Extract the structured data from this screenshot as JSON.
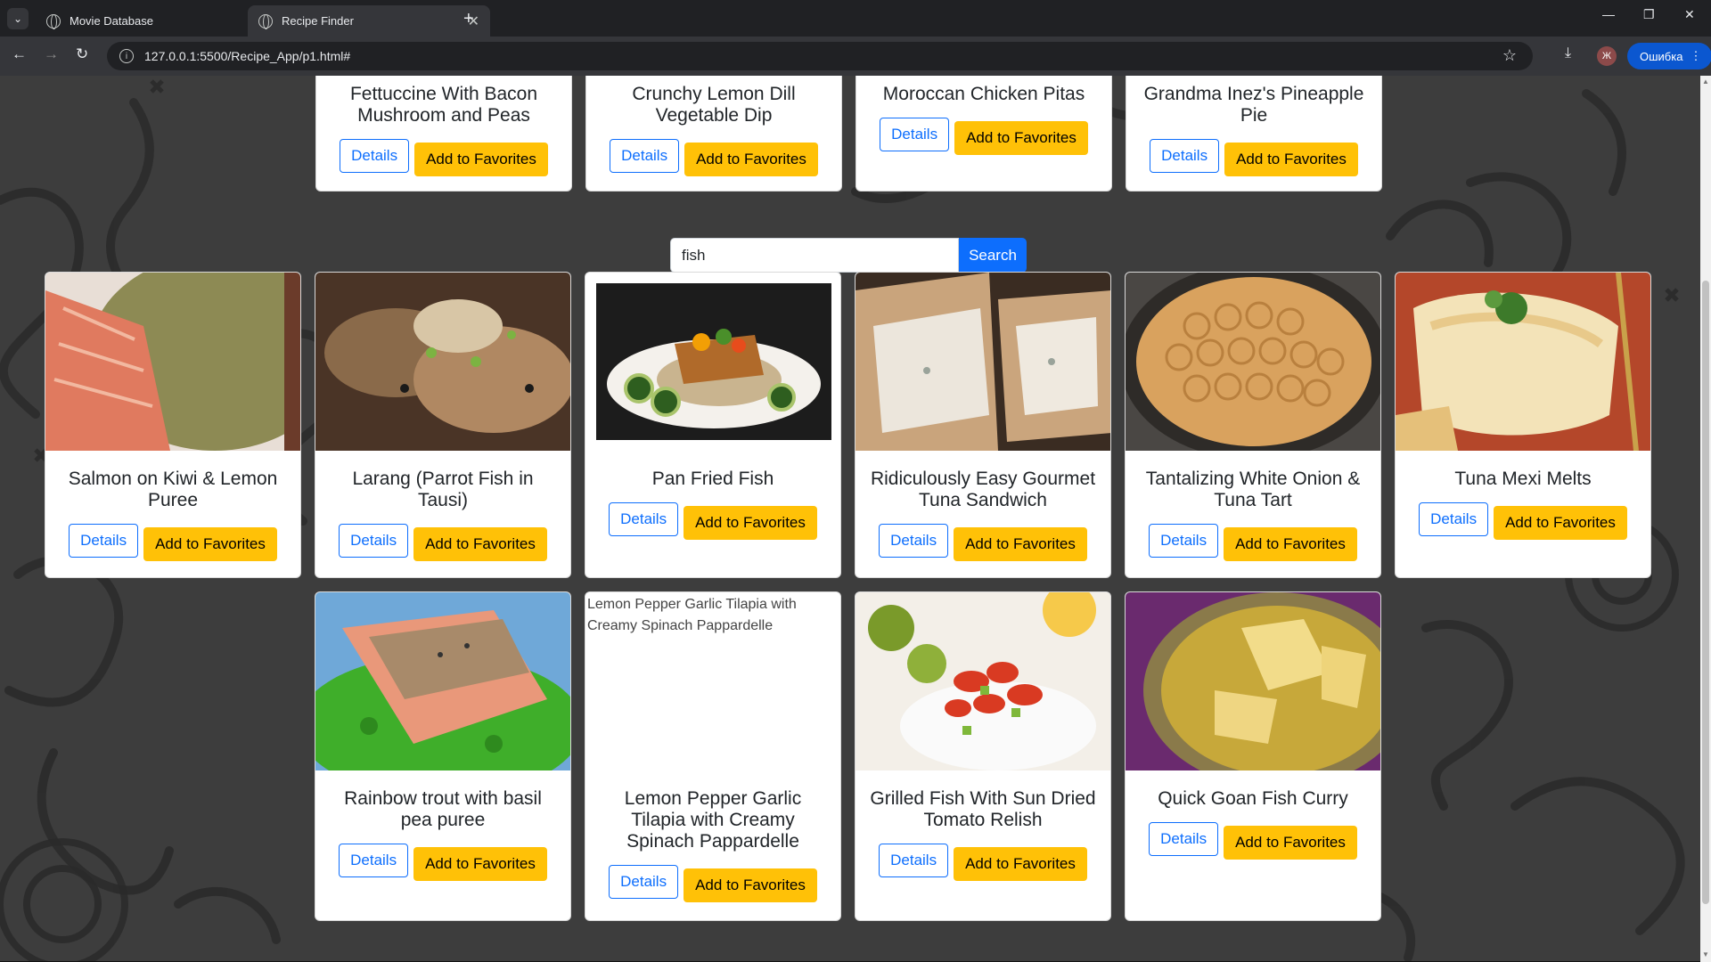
{
  "browser": {
    "tabs": [
      {
        "title": "Movie Database",
        "active": false
      },
      {
        "title": "Recipe Finder",
        "active": true
      }
    ],
    "url": "127.0.0.1:5500/Recipe_App/p1.html#",
    "profile_initial": "Ж",
    "error_button": "Ошибка"
  },
  "search": {
    "value": "fish",
    "button": "Search"
  },
  "labels": {
    "details": "Details",
    "favorite": "Add to Favorites"
  },
  "top_cards": [
    {
      "title": "Fettuccine With Bacon Mushroom and Peas"
    },
    {
      "title": "Crunchy Lemon Dill Vegetable Dip"
    },
    {
      "title": "Moroccan Chicken Pitas"
    },
    {
      "title": "Grandma Inez's Pineapple Pie"
    }
  ],
  "results": [
    {
      "title": "Salmon on Kiwi & Lemon Puree",
      "image": "salmon-on-kiwi-puree"
    },
    {
      "title": "Larang (Parrot Fish in Tausi)",
      "image": "larang-parrot-fish"
    },
    {
      "title": "Pan Fried Fish",
      "image": "pan-fried-fish"
    },
    {
      "title": "Ridiculously Easy Gourmet Tuna Sandwich",
      "image": "tuna-sandwich"
    },
    {
      "title": "Tantalizing White Onion & Tuna Tart",
      "image": "onion-tuna-tart"
    },
    {
      "title": "Tuna Mexi Melts",
      "image": "tuna-mexi-melts"
    },
    {
      "title": "Rainbow trout with basil pea puree",
      "image": "rainbow-trout"
    },
    {
      "title": "Lemon Pepper Garlic Tilapia with Creamy Spinach Pappardelle",
      "image": "broken",
      "alt": "Lemon Pepper Garlic Tilapia with Creamy Spinach Pappardelle"
    },
    {
      "title": "Grilled Fish With Sun Dried Tomato Relish",
      "image": "grilled-fish-relish"
    },
    {
      "title": "Quick Goan Fish Curry",
      "image": "goan-fish-curry"
    }
  ]
}
